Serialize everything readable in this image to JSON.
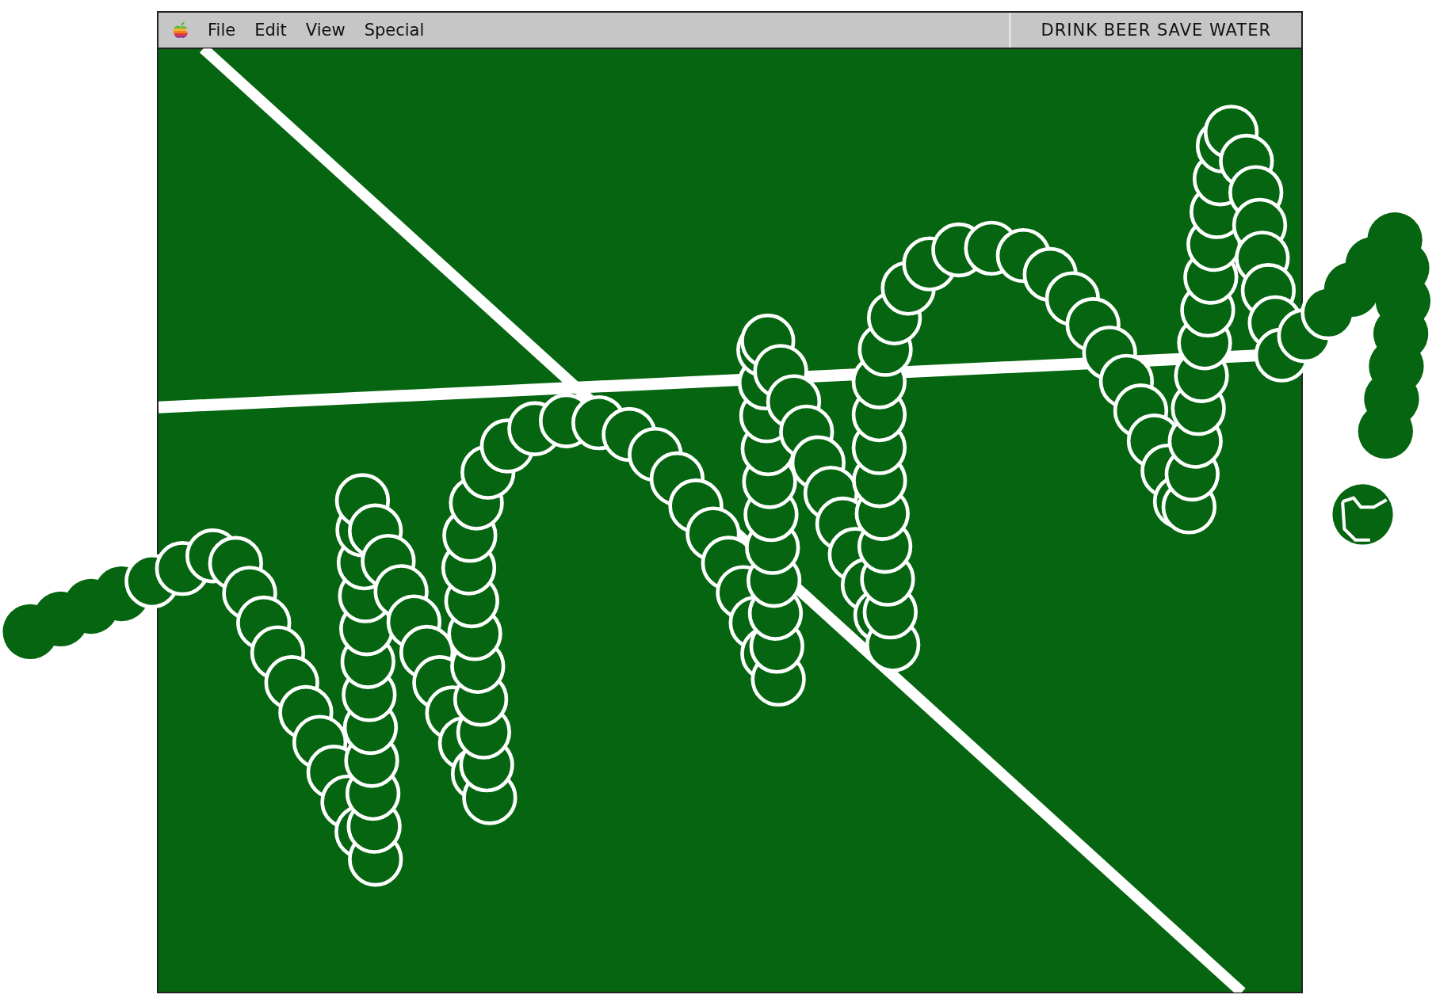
{
  "menu_bar": {
    "items": [
      "File",
      "Edit",
      "View",
      "Special"
    ],
    "status_text": "DRINK BEER SAVE WATER"
  }
}
